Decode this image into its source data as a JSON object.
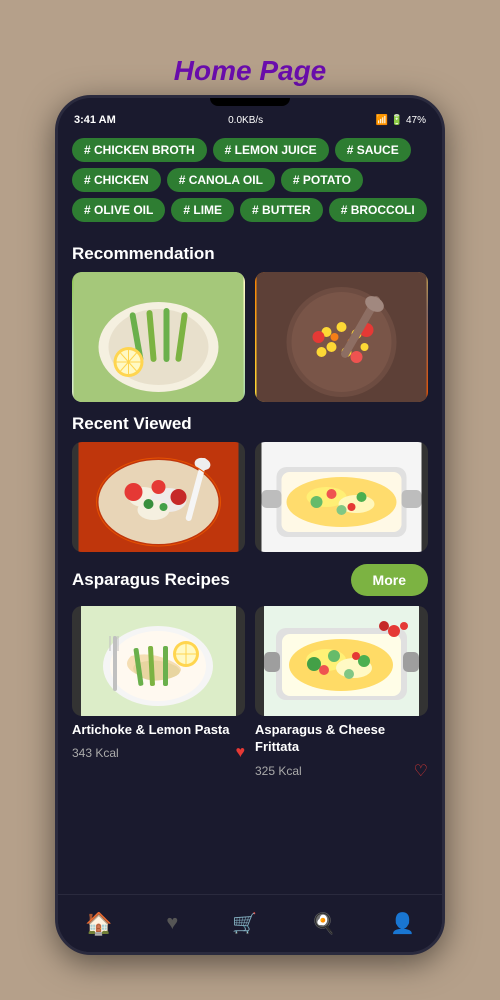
{
  "page": {
    "title": "Home Page",
    "background_color": "#b5a08a"
  },
  "status_bar": {
    "time": "3:41 AM",
    "data_speed": "0.0KB/s",
    "battery": "47"
  },
  "tags": {
    "row1": [
      {
        "label": "# CHICKEN BROTH"
      },
      {
        "label": "# LEMON JUICE"
      },
      {
        "label": "# SAUCE"
      }
    ],
    "row2": [
      {
        "label": "# CHICKEN"
      },
      {
        "label": "# CANOLA OIL"
      },
      {
        "label": "# POTATO"
      }
    ],
    "row3": [
      {
        "label": "# OLIVE OIL"
      },
      {
        "label": "# LIME"
      },
      {
        "label": "# BUTTER"
      },
      {
        "label": "# BROCCOLI"
      }
    ]
  },
  "sections": {
    "recommendation": {
      "title": "Recommendation"
    },
    "recent_viewed": {
      "title": "Recent Viewed"
    },
    "asparagus": {
      "title": "Asparagus Recipes",
      "more_btn": "More"
    }
  },
  "food_cards": [
    {
      "name": "Artichoke & Lemon Pasta",
      "kcal": "343 Kcal",
      "liked": true,
      "img_class": "img-artichoke-pasta"
    },
    {
      "name": "Asparagus & Cheese Frittata",
      "kcal": "325 Kcal",
      "liked": false,
      "img_class": "img-cheese-frittata"
    }
  ],
  "bottom_nav": [
    {
      "icon": "🏠",
      "label": "home",
      "active": true
    },
    {
      "icon": "♥",
      "label": "favorites",
      "active": false
    },
    {
      "icon": "🛒",
      "label": "cart",
      "active": false
    },
    {
      "icon": "🍳",
      "label": "cook",
      "active": false
    },
    {
      "icon": "👤",
      "label": "profile",
      "active": false
    }
  ]
}
